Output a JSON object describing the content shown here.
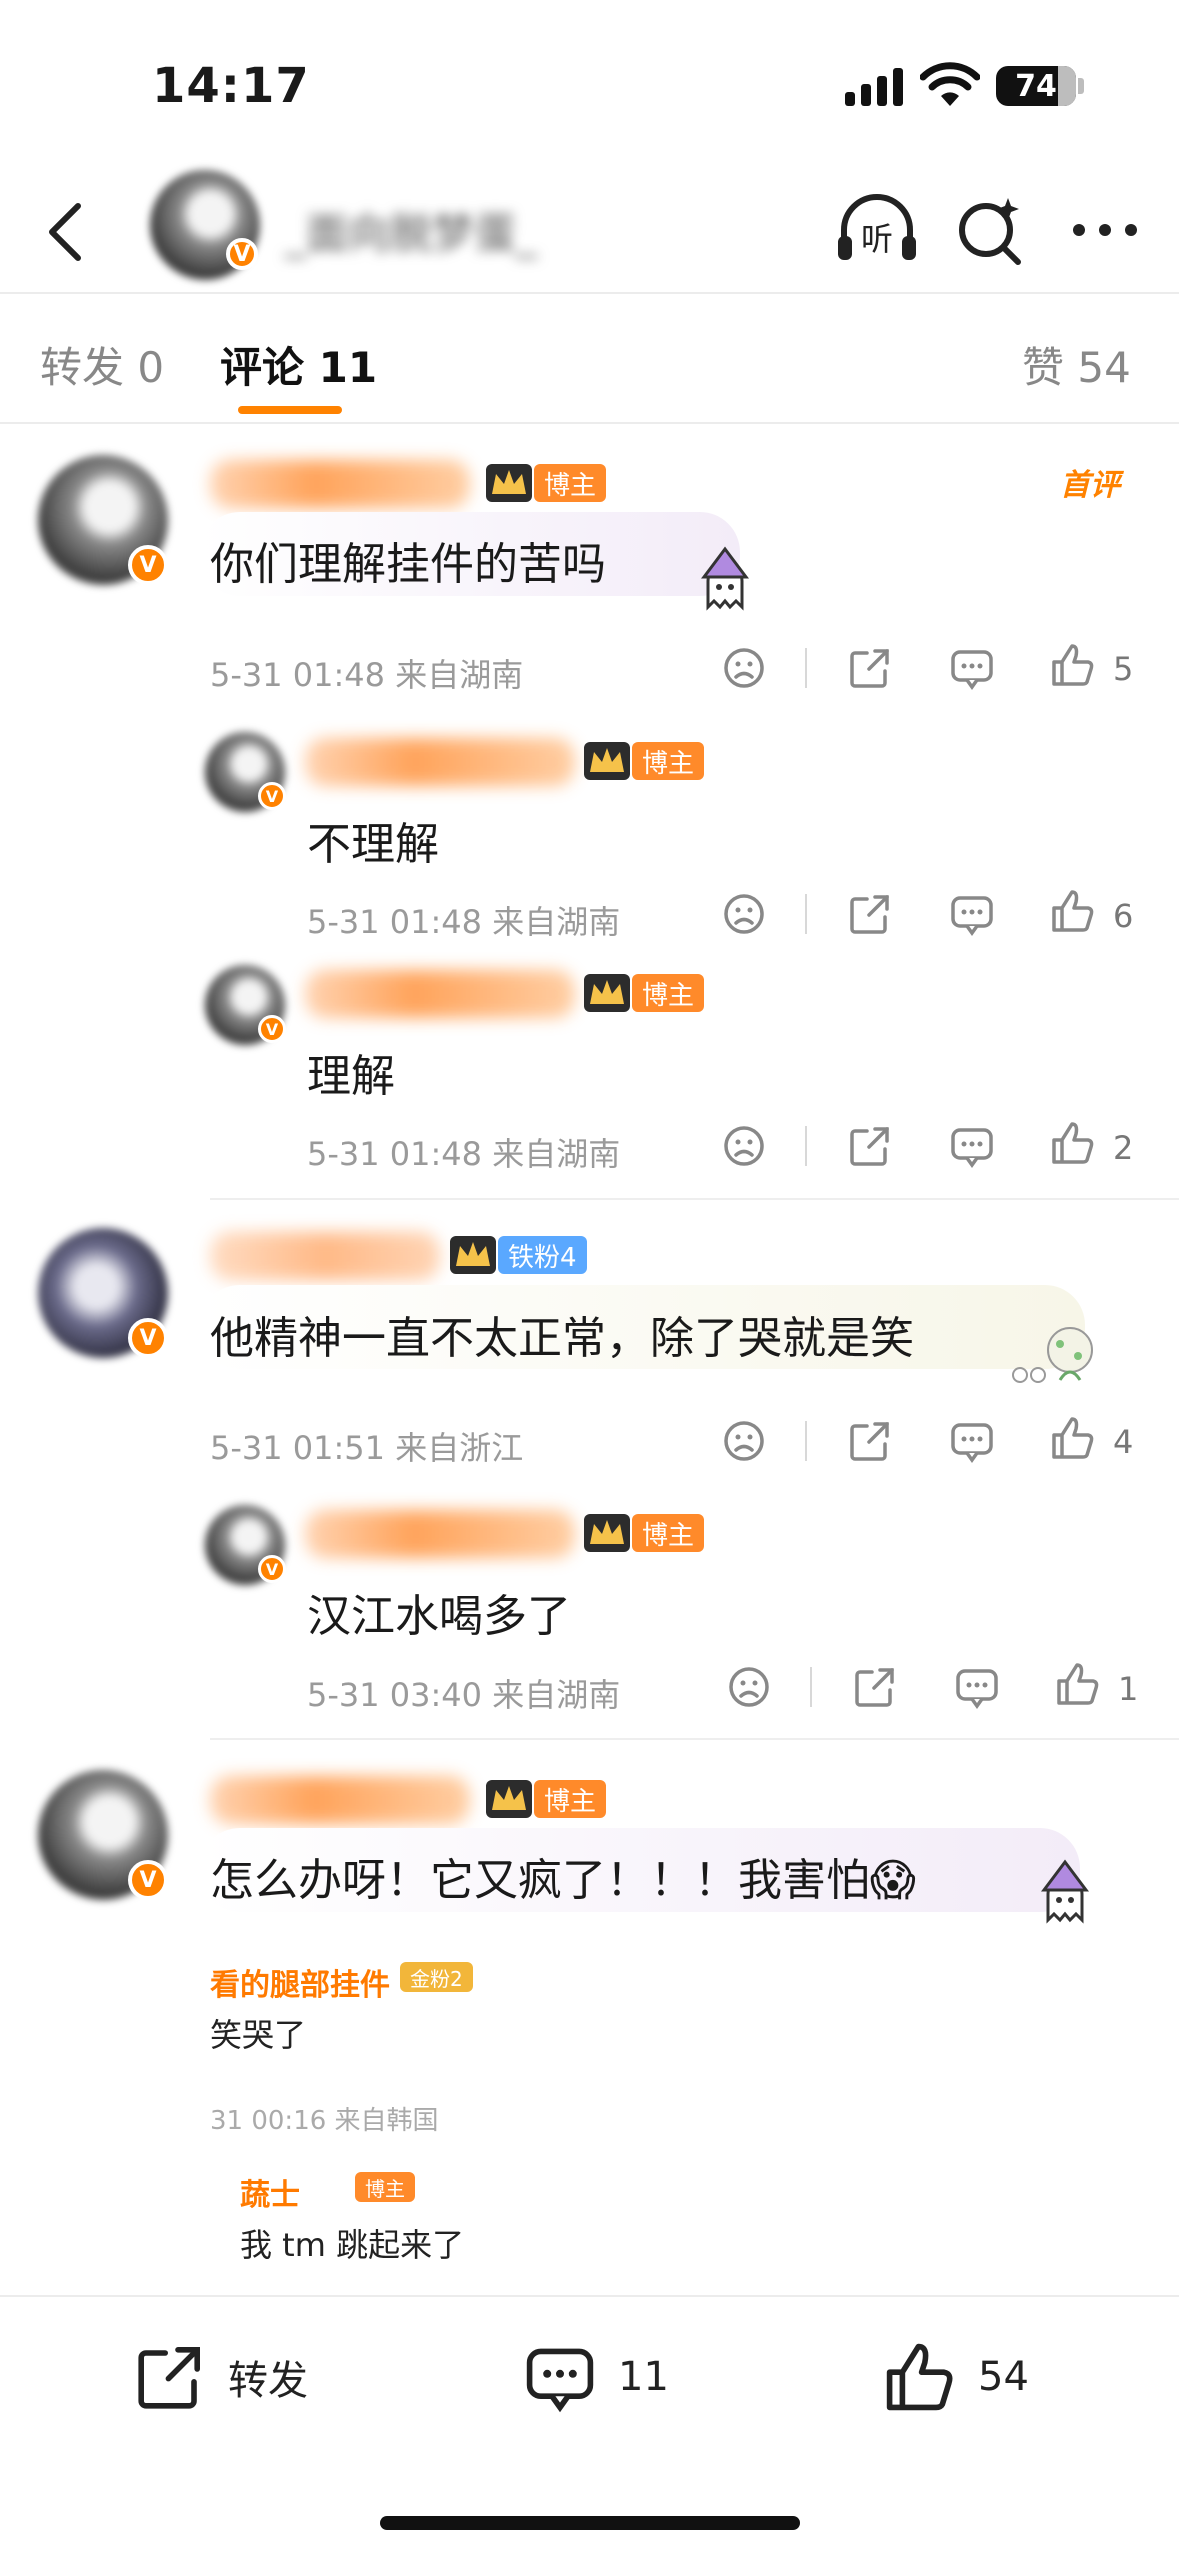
{
  "status_bar": {
    "time": "14:17",
    "battery": "74"
  },
  "nav": {
    "author_name_obscured": "_面向脱梦蛋_",
    "listen_label": "听"
  },
  "tabs": {
    "repost": "转发 0",
    "comments": "评论 11",
    "likes": "赞 54"
  },
  "comments": [
    {
      "badge": "博主",
      "first_label": "首评",
      "text": "你们理解挂件的苦吗",
      "meta": "5-31 01:48 来自湖南",
      "likes": "5",
      "replies": [
        {
          "badge": "博主",
          "text": "不理解",
          "meta": "5-31 01:48 来自湖南",
          "likes": "6"
        },
        {
          "badge": "博主",
          "text": "理解",
          "meta": "5-31 01:48 来自湖南",
          "likes": "2"
        }
      ]
    },
    {
      "badge": "铁粉4",
      "text": "他精神一直不太正常，除了哭就是笑",
      "meta": "5-31 01:51 来自浙江",
      "likes": "4",
      "replies": [
        {
          "badge": "博主",
          "text": "汉江水喝多了",
          "meta": "5-31 03:40 来自湖南",
          "likes": "1"
        }
      ]
    },
    {
      "badge": "博主",
      "text": "怎么办呀！它又疯了！！！我害怕😱",
      "embedded": {
        "name1": "看的腿部挂件",
        "badge1": "金粉2",
        "text1": "笑哭了",
        "meta1": "31 00:16 来自韩国",
        "name2": "蔬士",
        "badge2": "博主",
        "text2": "我 tm 跳起来了"
      }
    }
  ],
  "bottom_bar": {
    "repost": "转发",
    "comments": "11",
    "likes": "54"
  },
  "colors": {
    "accent": "#ff8200",
    "fan_badge": "#5aa8ff"
  }
}
